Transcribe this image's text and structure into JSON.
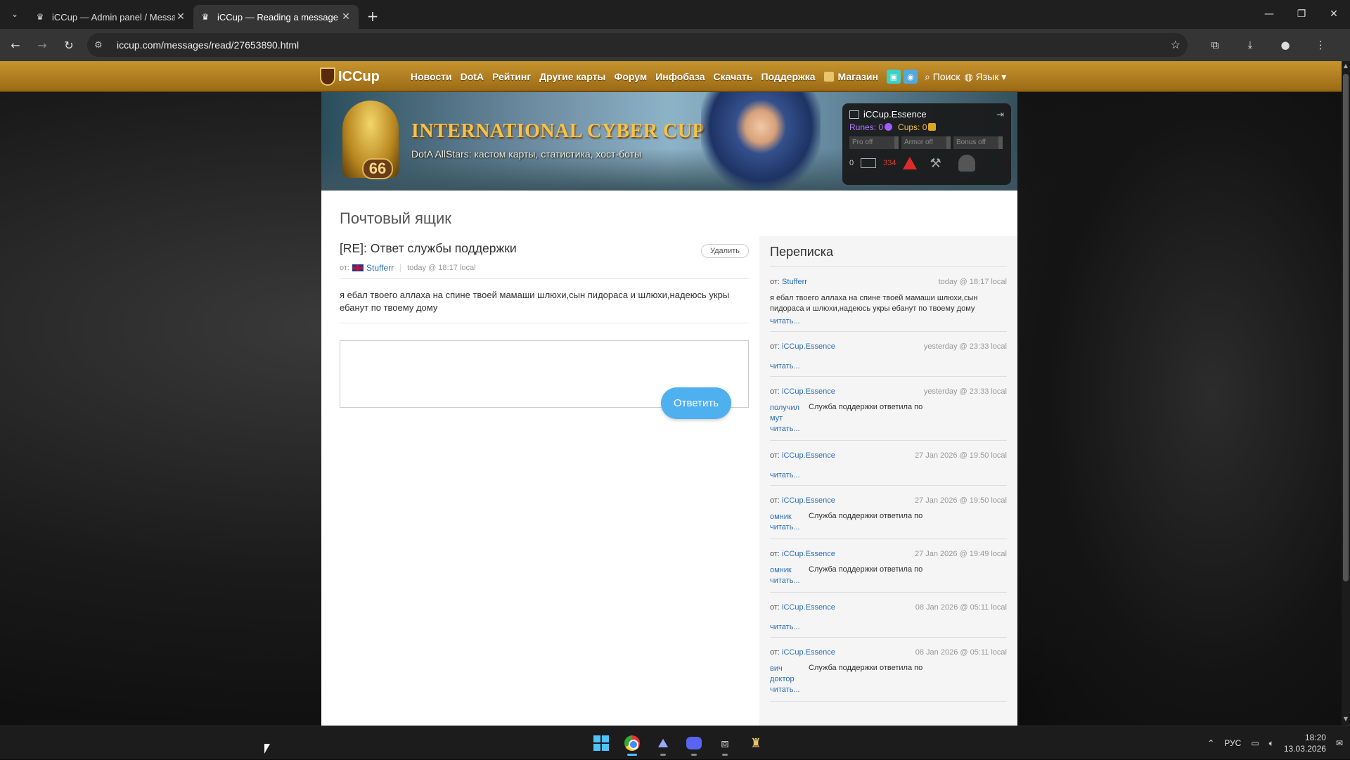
{
  "browser": {
    "tabs": [
      {
        "title": "iCCup — Admin panel / Messages",
        "active": false
      },
      {
        "title": "iCCup — Reading a message from",
        "active": true
      }
    ],
    "url": "iccup.com/messages/read/27653890.html"
  },
  "site_nav": {
    "logo": "ICCup",
    "items": [
      "Новости",
      "DotA",
      "Рейтинг",
      "Другие карты",
      "Форум",
      "Инфобаза",
      "Скачать",
      "Поддержка"
    ],
    "shop": "Магазин",
    "search": "Поиск",
    "lang": "Язык"
  },
  "banner": {
    "title": "INTERNATIONAL CYBER CUP",
    "subtitle": "DotA AllStars: кастом карты, статистика, хост-боты",
    "cup_number": "66"
  },
  "userbox": {
    "username": "iCCup.Essence",
    "runes_label": "Runes: 0",
    "cups_label": "Cups: 0",
    "toggles": [
      "Pro off",
      "Armor off",
      "Bonus off"
    ],
    "messages": "0",
    "warnings": "334"
  },
  "page": {
    "title": "Почтовый ящик",
    "subject": "[RE]: Ответ службы поддержки",
    "delete": "Удалить",
    "from_label": "от:",
    "author": "Stufferr",
    "date": "today @ 18:17 local",
    "body": "я ебал твоего аллаха на спине твоей мамаши шлюхи,сын пидораса и шлюхи,надеюсь укры ебанут по твоему дому",
    "reply_button": "Ответить"
  },
  "thread": {
    "title": "Переписка",
    "from_label": "от:",
    "read_label": "читать...",
    "items": [
      {
        "author": "Stufferr",
        "date": "today @ 18:17 local",
        "text": "я ебал твоего аллаха на спине твоей мамаши шлюхи,сын пидораса и шлюхи,надеюсь укры ебанут по твоему дому"
      },
      {
        "author": "iCCup.Essence",
        "date": "yesterday @ 23:33 local"
      },
      {
        "author": "iCCup.Essence",
        "date": "yesterday @ 23:33 local",
        "tag": [
          "получил",
          "мут"
        ],
        "preview": "Служба поддержки ответила по"
      },
      {
        "author": "iCCup.Essence",
        "date": "27 Jan 2026 @ 19:50 local"
      },
      {
        "author": "iCCup.Essence",
        "date": "27 Jan 2026 @ 19:50 local",
        "tag": [
          "омник"
        ],
        "preview": "Служба поддержки ответила по"
      },
      {
        "author": "iCCup.Essence",
        "date": "27 Jan 2026 @ 19:49 local",
        "tag": [
          "омник"
        ],
        "preview": "Служба поддержки ответила по"
      },
      {
        "author": "iCCup.Essence",
        "date": "08 Jan 2026 @ 05:11 local"
      },
      {
        "author": "iCCup.Essence",
        "date": "08 Jan 2026 @ 05:11 local",
        "tag": [
          "вич",
          "доктор"
        ],
        "preview": "Служба поддержки ответила по"
      }
    ]
  },
  "taskbar": {
    "lang": "РУС",
    "time": "18:20",
    "date": "13.03.2026"
  }
}
